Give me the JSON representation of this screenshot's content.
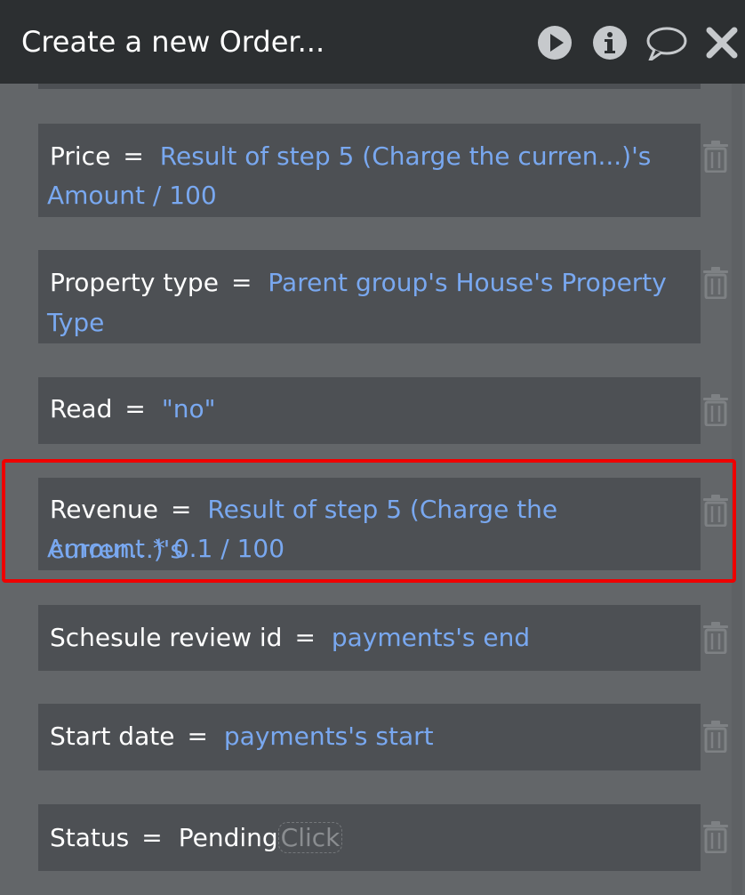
{
  "window": {
    "title": "Create a new Order..."
  },
  "toolbar": {
    "play_icon": "play-icon",
    "info_icon": "info-icon",
    "comment_icon": "speech-bubble-icon",
    "close_icon": "close-icon"
  },
  "fields": [
    {
      "name": "Price",
      "eq": "=",
      "line1": "Result of step 5 (Charge the curren...)'s",
      "line2": "Amount / 100"
    },
    {
      "name": "Property type",
      "eq": "=",
      "line1": "Parent group's House's Property",
      "line2": "Type"
    },
    {
      "name": "Read",
      "eq": "=",
      "line1": "\"no\""
    },
    {
      "name": "Revenue",
      "eq": "=",
      "line1": "Result of step 5 (Charge the curren...)'s",
      "line2": "Amount * 0.1 / 100"
    },
    {
      "name": "Schesule review id",
      "eq": "=",
      "line1": "payments's end"
    },
    {
      "name": "Start date",
      "eq": "=",
      "line1": "payments's start"
    },
    {
      "name": "Status",
      "eq": "=",
      "value": "Pending",
      "placeholder": "Click"
    }
  ],
  "colors": {
    "titlebar": "#2c2f31",
    "panel": "#636669",
    "row": "#4d5054",
    "expression": "#79a8f0",
    "highlight": "#ee0000"
  }
}
